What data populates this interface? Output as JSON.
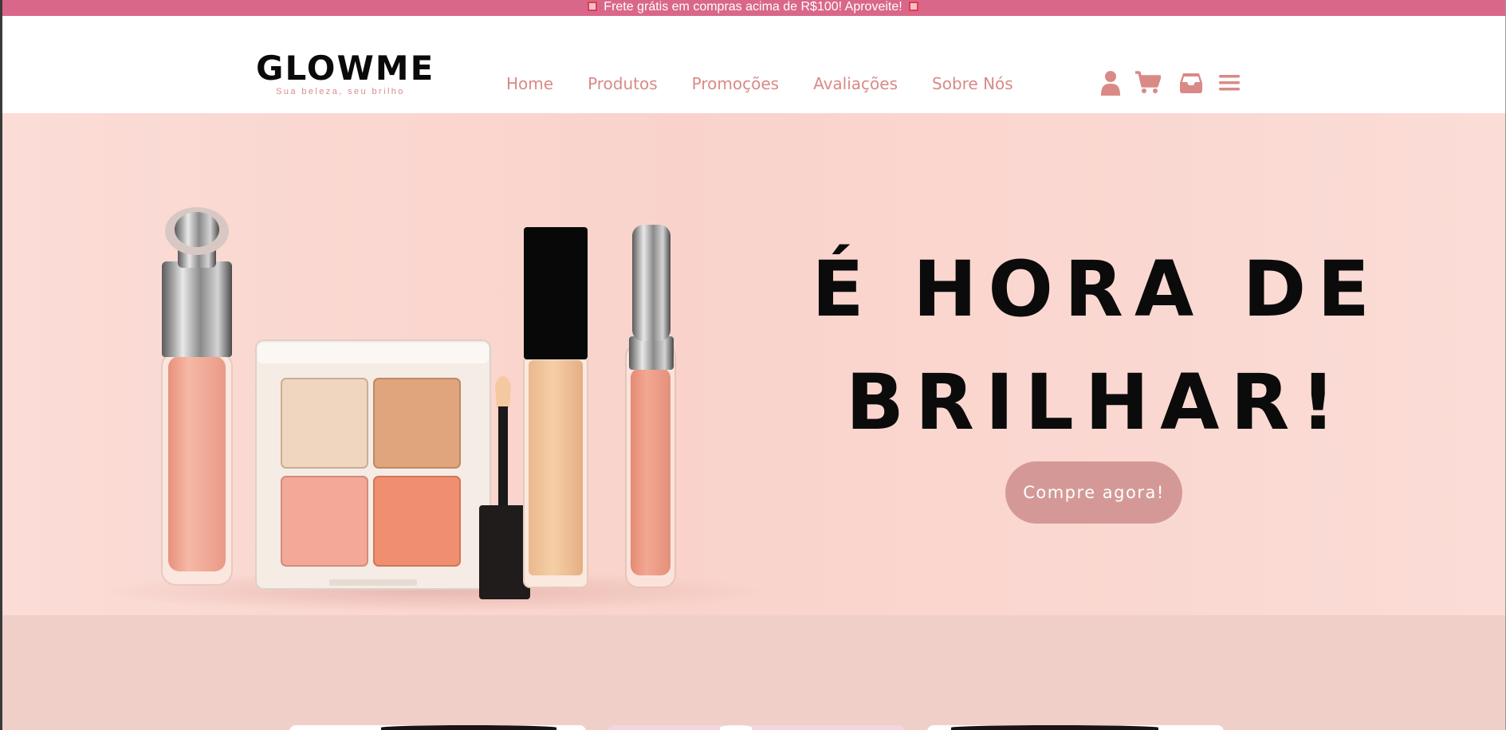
{
  "promo": {
    "text": "Frete grátis em compras acima de R$100! Aproveite!",
    "icon": "gift-icon"
  },
  "brand": {
    "name": "GLOWME",
    "tagline": "Sua beleza, seu brilho"
  },
  "nav": {
    "items": [
      {
        "label": "Home"
      },
      {
        "label": "Produtos"
      },
      {
        "label": "Promoções"
      },
      {
        "label": "Avaliações"
      },
      {
        "label": "Sobre Nós"
      }
    ]
  },
  "header_icons": [
    "user-icon",
    "cart-icon",
    "inbox-icon",
    "menu-icon"
  ],
  "hero": {
    "title_line1": "É HORA DE",
    "title_line2": "BRILHAR!",
    "cta_label": "Compre agora!",
    "image": "makeup-products-image"
  },
  "colors": {
    "promo_bar": "#d96789",
    "accent": "#d98a86",
    "cta": "#d49996",
    "hero_bg": "#f9d3cb",
    "lower_bg": "#f1cfc9",
    "title": "#0b0b0b"
  }
}
